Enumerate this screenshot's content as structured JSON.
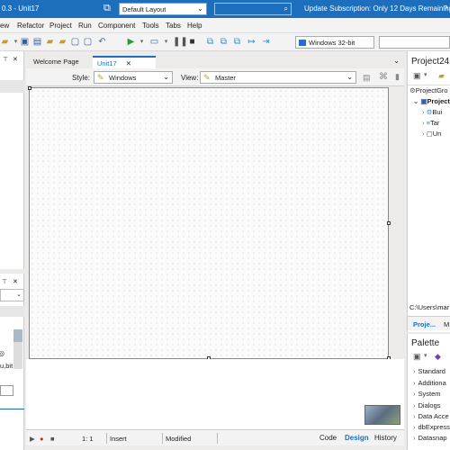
{
  "titlebar": {
    "title": "0.3 - Unit17",
    "layout": "Default Layout",
    "subscription": "Update Subscription: Only 12 Days Remaining",
    "help": "?"
  },
  "menu": [
    "ew",
    "Refactor",
    "Project",
    "Run",
    "Component",
    "Tools",
    "Tabs",
    "Help"
  ],
  "toolbar": {
    "platform": "Windows 32-bit"
  },
  "tabs": {
    "welcome": "Welcome Page",
    "unit": "Unit17",
    "close": "✕"
  },
  "editor_toolbar": {
    "style_label": "Style:",
    "style_value": "Windows",
    "view_label": "View:",
    "view_value": "Master"
  },
  "statusbar": {
    "position": "1:     1",
    "mode": "Insert",
    "state": "Modified",
    "code_tab": "Code",
    "design_tab": "Design",
    "history_tab": "History"
  },
  "project_panel": {
    "title": "Project24.",
    "tree": [
      "ProjectGro",
      "Project",
      "Bui",
      "Tar",
      "Un"
    ],
    "path": "C:\\Users\\mar",
    "tab_projects": "Proje...",
    "tab_model": "M"
  },
  "palette": {
    "title": "Palette",
    "categories": [
      "Standard",
      "Additiona",
      "System",
      "Dialogs",
      "Data Acce",
      "dbExpress",
      "Datasnap"
    ]
  },
  "left_panel": {
    "text": "u,bit"
  },
  "colors": {
    "accent": "#1d6fbe",
    "run_green": "#2d9a3b",
    "record_red": "#d52b1e"
  }
}
